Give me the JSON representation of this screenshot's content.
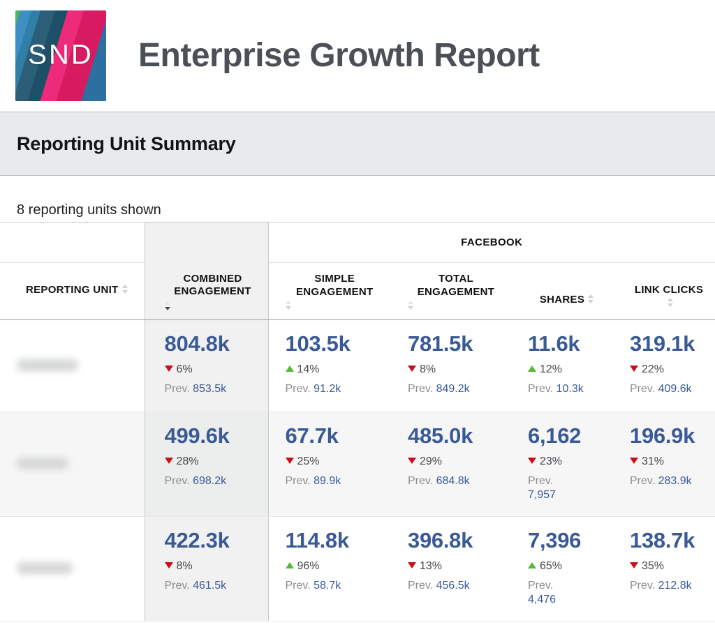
{
  "header": {
    "logo_text": "SND",
    "logo_name": "snd-logo",
    "title": "Enterprise Growth Report"
  },
  "section": {
    "title": "Reporting Unit Summary",
    "caption": "8 reporting units shown"
  },
  "table": {
    "group_headers": [
      {
        "label": "",
        "span": 1
      },
      {
        "label": "",
        "span": 1
      },
      {
        "label": "FACEBOOK",
        "span": 4
      }
    ],
    "facebook_group_label": "FACEBOOK",
    "columns": [
      {
        "key": "unit",
        "label": "REPORTING UNIT",
        "sort": "none"
      },
      {
        "key": "combined",
        "label": "COMBINED ENGAGEMENT",
        "sort": "desc"
      },
      {
        "key": "simple",
        "label": "SIMPLE ENGAGEMENT",
        "sort": "none"
      },
      {
        "key": "total",
        "label": "TOTAL ENGAGEMENT",
        "sort": "none"
      },
      {
        "key": "shares",
        "label": "SHARES",
        "sort": "none"
      },
      {
        "key": "links",
        "label": "LINK CLICKS",
        "sort": "none"
      }
    ],
    "prev_prefix": "Prev.",
    "rows": [
      {
        "unit": "",
        "combined": {
          "value": "804.8k",
          "delta": "6%",
          "dir": "down",
          "prev": "853.5k"
        },
        "simple": {
          "value": "103.5k",
          "delta": "14%",
          "dir": "up",
          "prev": "91.2k"
        },
        "total": {
          "value": "781.5k",
          "delta": "8%",
          "dir": "down",
          "prev": "849.2k"
        },
        "shares": {
          "value": "11.6k",
          "delta": "12%",
          "dir": "up",
          "prev": "10.3k"
        },
        "links": {
          "value": "319.1k",
          "delta": "22%",
          "dir": "down",
          "prev": "409.6k"
        }
      },
      {
        "unit": "",
        "combined": {
          "value": "499.6k",
          "delta": "28%",
          "dir": "down",
          "prev": "698.2k"
        },
        "simple": {
          "value": "67.7k",
          "delta": "25%",
          "dir": "down",
          "prev": "89.9k"
        },
        "total": {
          "value": "485.0k",
          "delta": "29%",
          "dir": "down",
          "prev": "684.8k"
        },
        "shares": {
          "value": "6,162",
          "delta": "23%",
          "dir": "down",
          "prev": "7,957"
        },
        "links": {
          "value": "196.9k",
          "delta": "31%",
          "dir": "down",
          "prev": "283.9k"
        }
      },
      {
        "unit": "",
        "combined": {
          "value": "422.3k",
          "delta": "8%",
          "dir": "down",
          "prev": "461.5k"
        },
        "simple": {
          "value": "114.8k",
          "delta": "96%",
          "dir": "up",
          "prev": "58.7k"
        },
        "total": {
          "value": "396.8k",
          "delta": "13%",
          "dir": "down",
          "prev": "456.5k"
        },
        "shares": {
          "value": "7,396",
          "delta": "65%",
          "dir": "up",
          "prev": "4,476"
        },
        "links": {
          "value": "138.7k",
          "delta": "35%",
          "dir": "down",
          "prev": "212.8k"
        }
      }
    ]
  },
  "colors": {
    "metric_blue": "#3a5a96",
    "delta_down_red": "#cc0c18",
    "delta_up_green": "#57b831",
    "band_gray": "#e8eaec",
    "title_gray": "#4a5056"
  }
}
